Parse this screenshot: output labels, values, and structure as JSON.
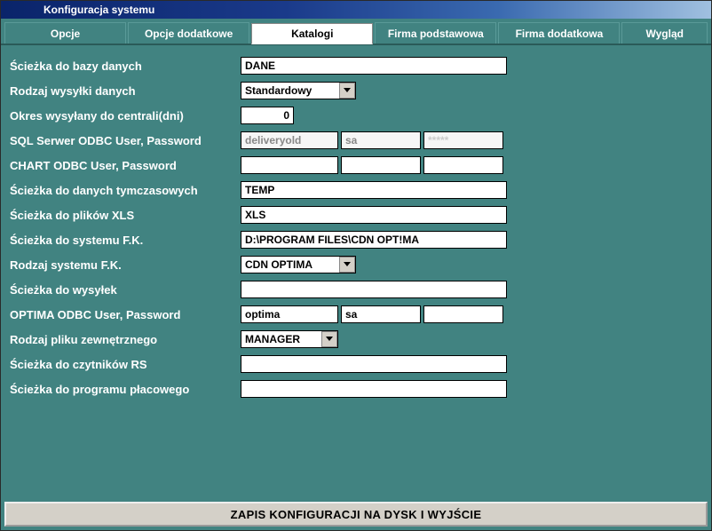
{
  "title": "Konfiguracja systemu",
  "tabs": {
    "opcje": "Opcje",
    "opcje_dodatkowe": "Opcje dodatkowe",
    "katalogi": "Katalogi",
    "firma_podstawowa": "Firma podstawowa",
    "firma_dodatkowa": "Firma dodatkowa",
    "wyglad": "Wygląd"
  },
  "labels": {
    "sciezka_bazy": "Ścieżka do bazy danych",
    "rodzaj_wysylki": "Rodzaj wysyłki danych",
    "okres_centrali": "Okres wysyłany do centrali(dni)",
    "sql_odbc": "SQL Serwer ODBC User, Password",
    "chart_odbc": "CHART ODBC User, Password",
    "sciezka_tmp": "Ścieżka do danych tymczasowych",
    "sciezka_xls": "Ścieżka do plików XLS",
    "sciezka_fk": "Ścieżka do systemu F.K.",
    "rodzaj_fk": "Rodzaj systemu F.K.",
    "sciezka_wysylek": "Ścieżka do wysyłek",
    "optima_odbc": "OPTIMA ODBC User, Password",
    "rodzaj_pliku": "Rodzaj pliku zewnętrznego",
    "sciezka_rs": "Ścieżka do czytników RS",
    "sciezka_plac": "Ścieżka do programu płacowego"
  },
  "values": {
    "sciezka_bazy": "DANE",
    "rodzaj_wysylki": "Standardowy",
    "okres_centrali": "0",
    "sql_odbc_dsn": "deliveryold",
    "sql_odbc_user": "sa",
    "sql_odbc_pass": "*****",
    "chart_odbc_dsn": "",
    "chart_odbc_user": "",
    "chart_odbc_pass": "",
    "sciezka_tmp": "TEMP",
    "sciezka_xls": "XLS",
    "sciezka_fk": "D:\\PROGRAM FILES\\CDN OPT!MA",
    "rodzaj_fk": "CDN OPTIMA",
    "sciezka_wysylek": "",
    "optima_odbc_dsn": "optima",
    "optima_odbc_user": "sa",
    "optima_odbc_pass": "",
    "rodzaj_pliku": "MANAGER",
    "sciezka_rs": "",
    "sciezka_plac": ""
  },
  "footer": "ZAPIS KONFIGURACJI NA DYSK I WYJŚCIE"
}
